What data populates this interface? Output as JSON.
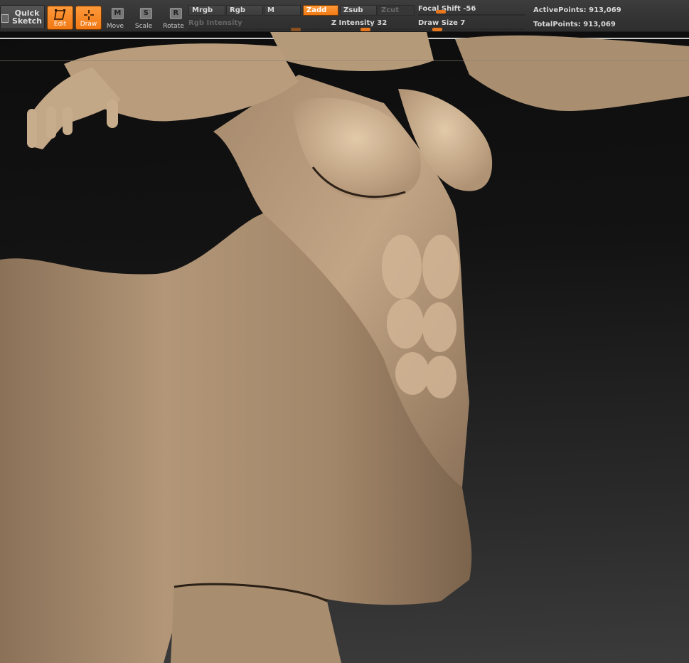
{
  "toolbar": {
    "quick_sketch": "Quick Sketch",
    "edit": "Edit",
    "draw": "Draw",
    "move": "Move",
    "move_key": "M",
    "scale": "Scale",
    "scale_key": "S",
    "rotate": "Rotate",
    "rotate_key": "R",
    "mrgb": "Mrgb",
    "rgb": "Rgb",
    "m": "M",
    "zadd": "Zadd",
    "zsub": "Zsub",
    "zcut": "Zcut",
    "rgb_intensity": "Rgb Intensity",
    "z_intensity": "Z Intensity 32",
    "focal_shift": "Focal Shift -56",
    "draw_size": "Draw Size 7",
    "active_points": "ActivePoints: 913,069",
    "total_points": "TotalPoints: 913,069"
  },
  "sliders": {
    "rgb_intensity_fraction": 0.95,
    "z_intensity_fraction": 0.32,
    "focal_shift_value": -56,
    "draw_size_value": 7
  },
  "colors": {
    "accent": "#f07a14",
    "toolbar_bg": "#383838",
    "clay": "#b09373",
    "canvas_bg": "#141414"
  },
  "canvas": {
    "model_description_icon": "centaur-sculpt"
  }
}
